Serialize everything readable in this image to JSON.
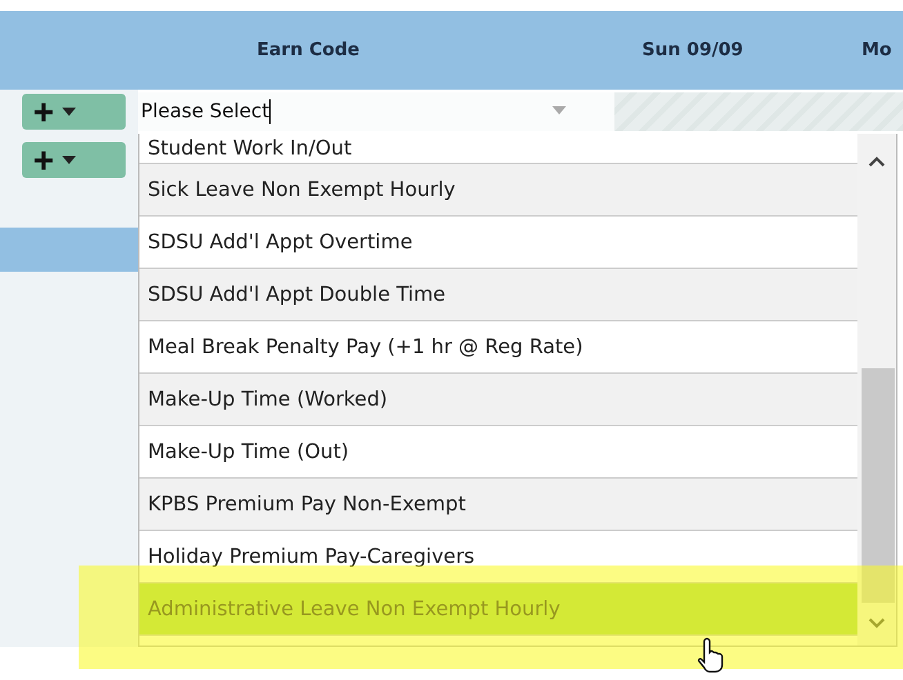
{
  "header": {
    "columns": [
      "Earn Code",
      "Sun 09/09",
      "Mo"
    ]
  },
  "select": {
    "value": "Please Select"
  },
  "add_buttons": [
    {
      "label": "+"
    },
    {
      "label": "+"
    }
  ],
  "dropdown": {
    "items": [
      {
        "label": "Student Work In/Out",
        "selected": false
      },
      {
        "label": "Sick Leave Non Exempt Hourly",
        "selected": false
      },
      {
        "label": "SDSU Add'l Appt Overtime",
        "selected": false
      },
      {
        "label": "SDSU Add'l Appt Double Time",
        "selected": false
      },
      {
        "label": "Meal Break Penalty Pay (+1 hr @ Reg Rate)",
        "selected": false
      },
      {
        "label": "Make-Up Time (Worked)",
        "selected": false
      },
      {
        "label": "Make-Up Time (Out)",
        "selected": false
      },
      {
        "label": "KPBS Premium Pay Non-Exempt",
        "selected": false
      },
      {
        "label": "Holiday Premium Pay-Caregivers",
        "selected": false
      },
      {
        "label": "Administrative Leave Non Exempt Hourly",
        "selected": true
      }
    ]
  }
}
